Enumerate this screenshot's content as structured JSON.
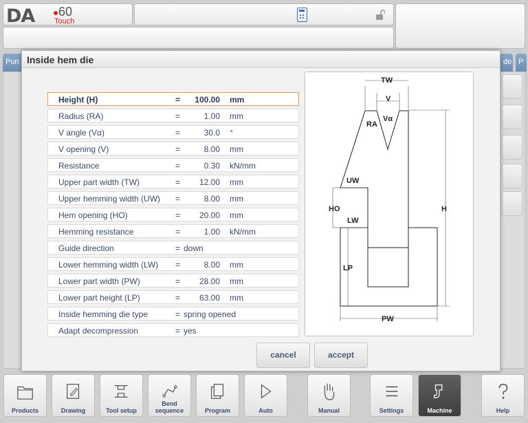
{
  "header": {
    "logo": {
      "brand": "DA",
      "model": "60",
      "variant": "Touch"
    },
    "center_icon": "calculator-icon",
    "lock_icon": "unlocked-padlock-icon"
  },
  "background": {
    "left_tab": "Pun",
    "right_tab_1": "de",
    "right_tab_2": "P"
  },
  "dialog": {
    "title": "Inside hem die",
    "params": [
      {
        "label": "Height (H)",
        "eq": "=",
        "value": "100.00",
        "unit": "mm",
        "selected": true
      },
      {
        "label": "Radius (RA)",
        "eq": "=",
        "value": "1.00",
        "unit": "mm"
      },
      {
        "label": "V angle (Vα)",
        "eq": "=",
        "value": "30.0",
        "unit": "°"
      },
      {
        "label": "V opening (V)",
        "eq": "=",
        "value": "8.00",
        "unit": "mm"
      },
      {
        "label": "Resistance",
        "eq": "=",
        "value": "0.30",
        "unit": "kN/mm"
      },
      {
        "label": "Upper part width (TW)",
        "eq": "=",
        "value": "12.00",
        "unit": "mm"
      },
      {
        "label": "Upper hemming width (UW)",
        "eq": "=",
        "value": "8.00",
        "unit": "mm"
      },
      {
        "label": "Hem opening (HO)",
        "eq": "=",
        "value": "20.00",
        "unit": "mm"
      },
      {
        "label": "Hemming resistance",
        "eq": "=",
        "value": "1.00",
        "unit": "kN/mm"
      },
      {
        "label": "Guide direction",
        "eq": "=",
        "text": "down"
      },
      {
        "label": "Lower hemming width (LW)",
        "eq": "=",
        "value": "8.00",
        "unit": "mm"
      },
      {
        "label": "Lower part width (PW)",
        "eq": "=",
        "value": "28.00",
        "unit": "mm"
      },
      {
        "label": "Lower part height (LP)",
        "eq": "=",
        "value": "63.00",
        "unit": "mm"
      },
      {
        "label": "Inside hemming die type",
        "eq": "=",
        "text": "spring opened"
      },
      {
        "label": "Adapt decompression",
        "eq": "=",
        "text": "yes"
      }
    ],
    "drawing_labels": {
      "tw": "TW",
      "v": "V",
      "ra": "RA",
      "va": "Vα",
      "uw": "UW",
      "ho": "HO",
      "lw": "LW",
      "h": "H",
      "lp": "LP",
      "pw": "PW"
    },
    "cancel_label": "cancel",
    "accept_label": "accept"
  },
  "toolbar": {
    "items": [
      {
        "label": "Products",
        "icon": "folder-icon"
      },
      {
        "label": "Drawing",
        "icon": "pencil-drawing-icon"
      },
      {
        "label": "Tool setup",
        "icon": "tool-setup-icon"
      },
      {
        "label": "Bend sequence",
        "icon": "bend-sequence-icon"
      },
      {
        "label": "Program",
        "icon": "program-pages-icon"
      },
      {
        "label": "Auto",
        "icon": "play-icon"
      },
      {
        "label": "Manual",
        "icon": "hand-icon"
      },
      {
        "label": "Settings",
        "icon": "settings-list-icon"
      },
      {
        "label": "Machine",
        "icon": "machine-icon",
        "active": true
      },
      {
        "label": "Help",
        "icon": "help-question-icon"
      }
    ]
  }
}
